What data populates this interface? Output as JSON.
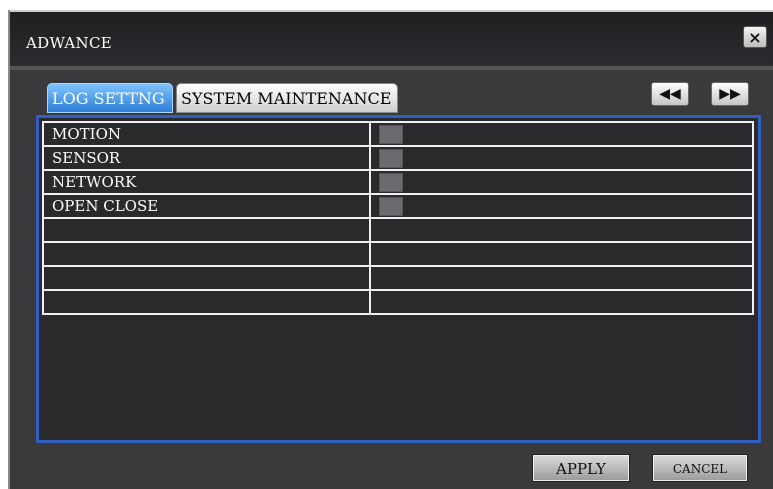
{
  "window": {
    "title": "ADWANCE",
    "close_icon": "close-icon",
    "close_label": "×"
  },
  "tabs": [
    {
      "label": "LOG SETTNG",
      "active": true
    },
    {
      "label": "SYSTEM MAINTENANCE",
      "active": false
    }
  ],
  "nav": {
    "prev_icon": "rewind-icon",
    "prev_glyph": "◀◀",
    "next_icon": "fast-forward-icon",
    "next_glyph": "▶▶"
  },
  "log_rows": [
    {
      "label": "MOTION",
      "checkbox": true
    },
    {
      "label": "SENSOR",
      "checkbox": true
    },
    {
      "label": "NETWORK",
      "checkbox": true
    },
    {
      "label": "OPEN CLOSE",
      "checkbox": true
    },
    {
      "label": "",
      "checkbox": false
    },
    {
      "label": "",
      "checkbox": false
    },
    {
      "label": "",
      "checkbox": false
    },
    {
      "label": "",
      "checkbox": false
    }
  ],
  "buttons": {
    "apply": "APPLY",
    "cancel": "CANCEL"
  },
  "colors": {
    "window_bg": "#2a2a2d",
    "active_tab": "#2f7fd8",
    "panel_border": "#2f5fbf",
    "checkbox": "#6b6b6f"
  }
}
